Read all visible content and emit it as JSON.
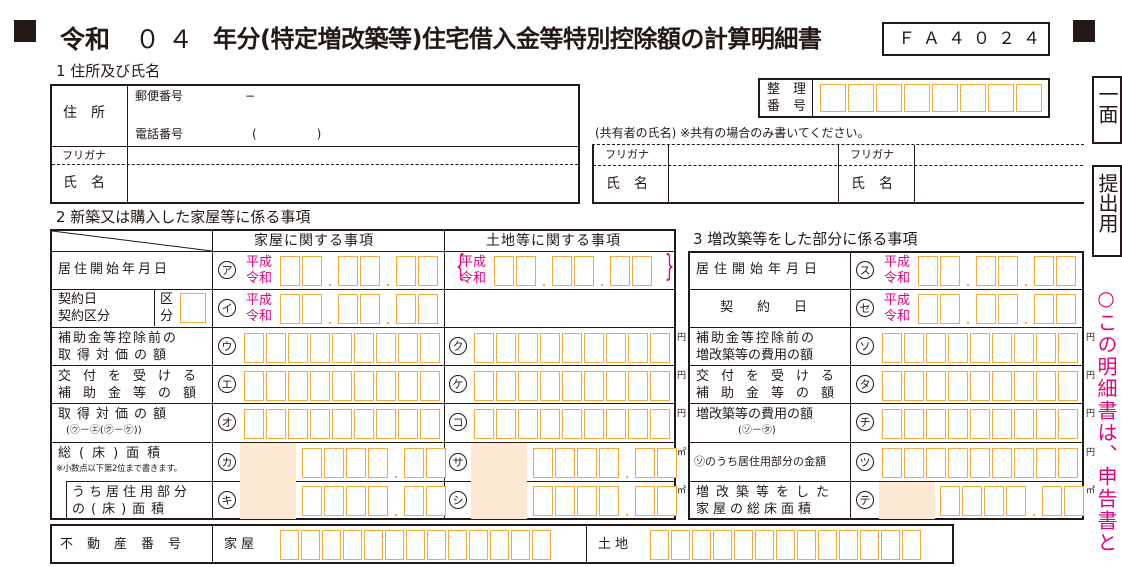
{
  "header": {
    "era": "令和",
    "year": "０４",
    "title": "年分(特定増改築等)住宅借入金等特別控除額の計算明細書",
    "form_code": "ＦＡ４０２４"
  },
  "right_tabs": {
    "ichimen": "一面",
    "teishutsu": "提出用",
    "note": "○この明細書は、申告書と"
  },
  "section1": {
    "heading": "1  住所及び氏名",
    "jusho": "住　所",
    "postal": "郵便番号",
    "postal_dash": "−",
    "phone": "電話番号",
    "phone_paren": "(　　　　　)",
    "furigana": "フリガナ",
    "shimei": "氏　名",
    "seiri_label": "整　理\n番　号",
    "seiri_1": "整　理",
    "seiri_2": "番　号",
    "co_owner_note": "(共有者の氏名) ※共有の場合のみ書いてください。",
    "co_furigana_1": "フリガナ",
    "co_shimei_1": "氏　名",
    "co_furigana_2": "フリガナ",
    "co_shimei_2": "氏　名"
  },
  "section2": {
    "heading": "2  新築又は購入した家屋等に係る事項",
    "col_house": "家屋に関する事項",
    "col_land": "土地等に関する事項",
    "rows": {
      "start": "居住開始年月日",
      "contract_1": "契約日",
      "contract_2": "契約区分",
      "kubun": "区\n分",
      "kubun_1": "区",
      "kubun_2": "分",
      "hojo_1": "補助金等控除前の",
      "hojo_2": "取得対価の額",
      "kofu_1": "交付を受ける",
      "kofu_2": "補助金等の額",
      "shutoku_1": "取得対価の額",
      "shutoku_2": "(㋒－㋓(㋗－㋘))",
      "menseki_1": "総(床)面積",
      "menseki_note": "※小数点以下第2位まで書きます。",
      "kyoju_1": "うち居住用部分",
      "kyoju_2": "の(床)面積"
    },
    "era_heisei": "平成",
    "era_reiwa": "令和",
    "marks_house": [
      "ア",
      "イ",
      "ウ",
      "エ",
      "オ",
      "カ",
      "キ"
    ],
    "marks_land": [
      "ク",
      "ケ",
      "コ",
      "サ",
      "シ"
    ],
    "unit_yen": "円",
    "unit_m2": "㎡"
  },
  "section3": {
    "heading": "3  増改築等をした部分に係る事項",
    "rows": {
      "start": "居住開始年月日",
      "contract": "契約日",
      "hojo_1": "補助金等控除前の",
      "hojo_2": "増改築等の費用の額",
      "kofu_1": "交付を受ける",
      "kofu_2": "補助金等の額",
      "hiyo_1": "増改築等の費用の額",
      "hiyo_2": "(㋞－㋟)",
      "kyoju": "㋞のうち居住用部分の金額",
      "total_1": "増改築等をした",
      "total_2": "家屋の総床面積"
    },
    "marks": [
      "ス",
      "セ",
      "ソ",
      "タ",
      "チ",
      "ツ",
      "テ"
    ]
  },
  "fudosan": {
    "label": "不動産番号",
    "kaoku": "家屋",
    "tochi": "土地"
  }
}
